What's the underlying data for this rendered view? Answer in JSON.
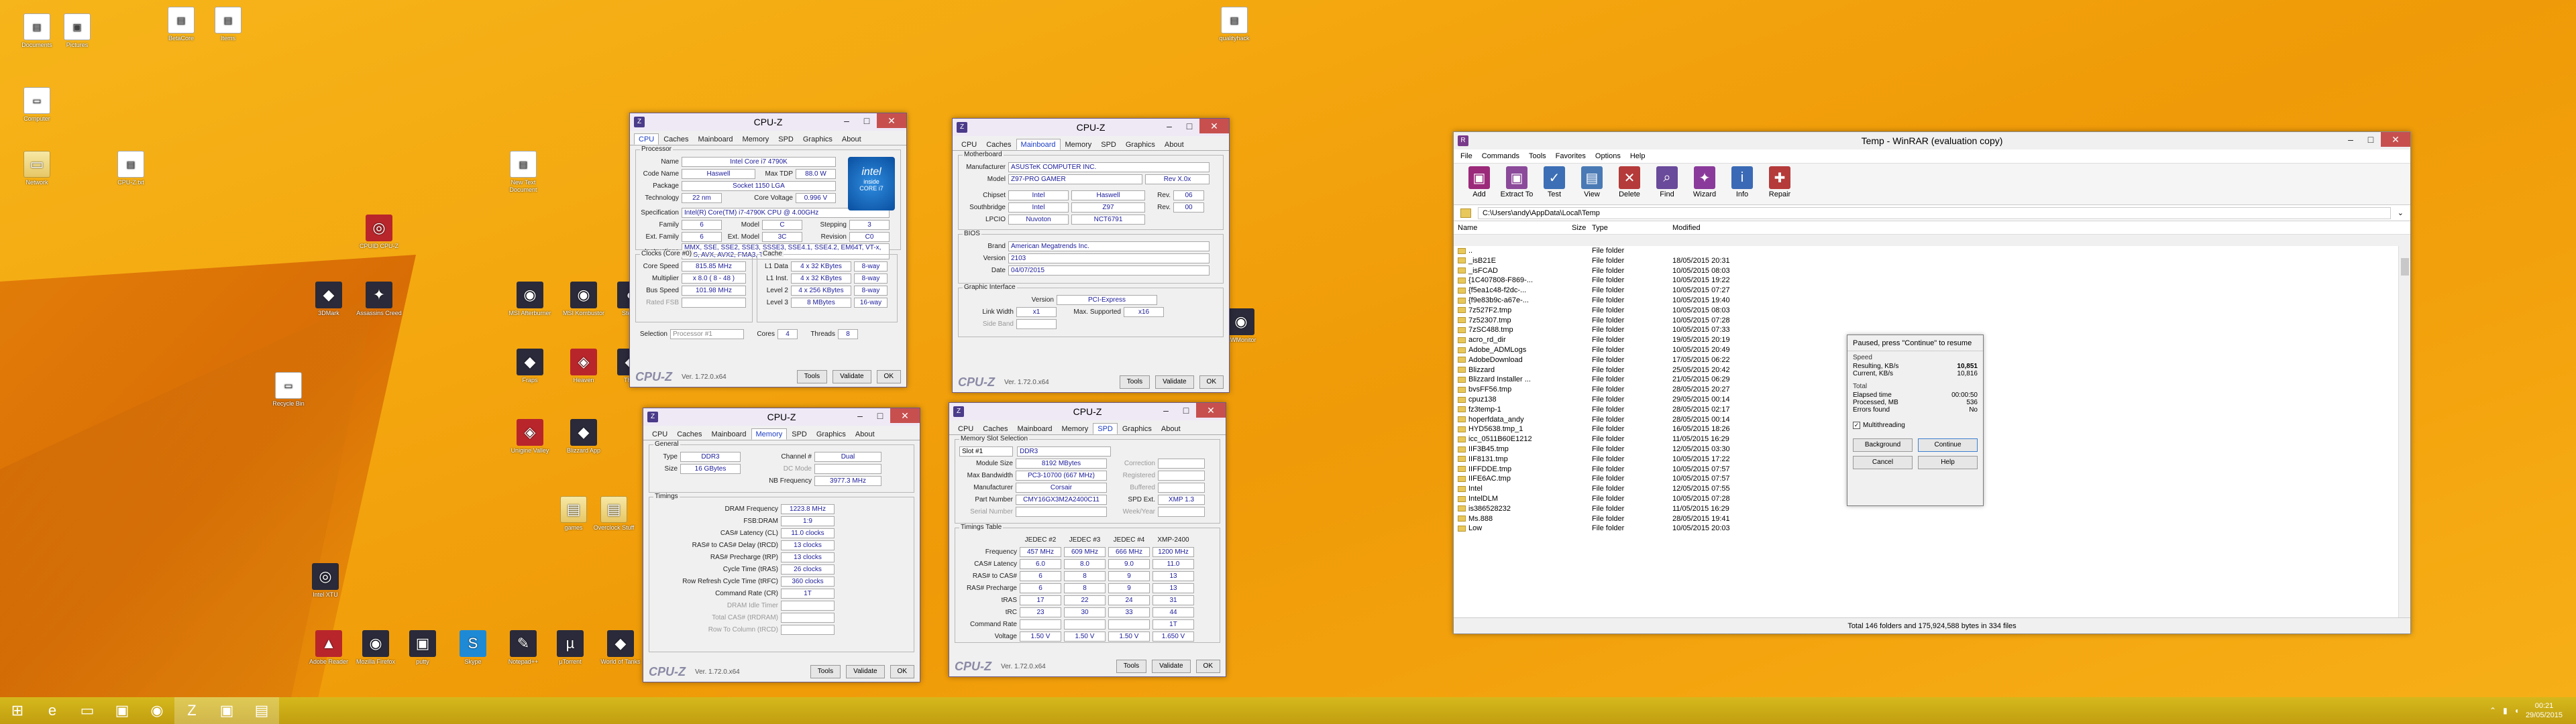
{
  "desktop": {
    "icons": [
      {
        "label": "Documents",
        "glyph": "▤",
        "kind": "doc"
      },
      {
        "label": "Pictures",
        "glyph": "▣",
        "kind": "doc"
      },
      {
        "label": "BetaCore",
        "glyph": "▤",
        "kind": "doc"
      },
      {
        "label": "Items",
        "glyph": "▤",
        "kind": "doc"
      },
      {
        "label": "Computer",
        "glyph": "▭",
        "kind": "doc"
      },
      {
        "label": "Network",
        "glyph": "▭",
        "kind": "fold"
      },
      {
        "label": "CPU-Z.txt",
        "glyph": "▤",
        "kind": "doc"
      },
      {
        "label": "New Text Document",
        "glyph": "▤",
        "kind": "doc"
      },
      {
        "label": "CPUID CPU-Z",
        "glyph": "◎",
        "kind": "red"
      },
      {
        "label": "3DMark",
        "glyph": "◆",
        "kind": "dark"
      },
      {
        "label": "Assassins Creed",
        "glyph": "✦",
        "kind": "dark"
      },
      {
        "label": "MSI Afterburner",
        "glyph": "◉",
        "kind": "dark"
      },
      {
        "label": "MSI Kombustor",
        "glyph": "◉",
        "kind": "dark"
      },
      {
        "label": "Steam",
        "glyph": "◐",
        "kind": "dark"
      },
      {
        "label": "Fraps",
        "glyph": "◆",
        "kind": "dark"
      },
      {
        "label": "Heaven",
        "glyph": "◈",
        "kind": "red"
      },
      {
        "label": "Thief",
        "glyph": "◆",
        "kind": "dark"
      },
      {
        "label": "Unigine Valley",
        "glyph": "◈",
        "kind": "red"
      },
      {
        "label": "Blizzard App",
        "glyph": "◆",
        "kind": "dark"
      },
      {
        "label": "Recycle Bin",
        "glyph": "▭",
        "kind": "doc"
      },
      {
        "label": "qualityhack",
        "glyph": "▤",
        "kind": "doc"
      },
      {
        "label": "games",
        "glyph": "▤",
        "kind": "fold"
      },
      {
        "label": "Overclock Stuff",
        "glyph": "▤",
        "kind": "fold"
      },
      {
        "label": "Adobe Reader",
        "glyph": "▲",
        "kind": "red"
      },
      {
        "label": "Mozilla Firefox",
        "glyph": "◉",
        "kind": "dark"
      },
      {
        "label": "putty",
        "glyph": "▣",
        "kind": "dark"
      },
      {
        "label": "Skype",
        "glyph": "S",
        "kind": "blue"
      },
      {
        "label": "Notepad++",
        "glyph": "✎",
        "kind": "dark"
      },
      {
        "label": "µTorrent",
        "glyph": "µ",
        "kind": "dark"
      },
      {
        "label": "World of Tanks",
        "glyph": "◆",
        "kind": "dark"
      },
      {
        "label": "Intel XTU",
        "glyph": "◎",
        "kind": "dark"
      },
      {
        "label": "HWMonitor",
        "glyph": "◉",
        "kind": "dark"
      }
    ]
  },
  "cpuz1": {
    "title": "CPU-Z",
    "tabs": [
      "CPU",
      "Caches",
      "Mainboard",
      "Memory",
      "SPD",
      "Graphics",
      "About"
    ],
    "active": "CPU",
    "processor_label": "Processor",
    "name_k": "Name",
    "name": "Intel Core i7 4790K",
    "code_k": "Code Name",
    "code": "Haswell",
    "tdp_k": "Max TDP",
    "tdp": "88.0 W",
    "package_k": "Package",
    "package": "Socket 1150 LGA",
    "tech_k": "Technology",
    "tech": "22 nm",
    "volt_k": "Core Voltage",
    "volt": "0.996 V",
    "spec_k": "Specification",
    "spec": "Intel(R) Core(TM) i7-4790K CPU @ 4.00GHz",
    "fam_k": "Family",
    "fam": "6",
    "model_k": "Model",
    "model": "C",
    "step_k": "Stepping",
    "step": "3",
    "efam_k": "Ext. Family",
    "efam": "6",
    "emod_k": "Ext. Model",
    "emod": "3C",
    "rev_k": "Revision",
    "rev": "C0",
    "instr_k": "Instructions",
    "instr": "MMX, SSE, SSE2, SSE3, SSSE3, SSE4.1, SSE4.2, EM64T, VT-x, AES, AVX, AVX2, FMA3, TSX",
    "clocks_label": "Clocks (Core #0)",
    "cs_k": "Core Speed",
    "cs": "815.85 MHz",
    "mul_k": "Multiplier",
    "mul": "x 8.0 ( 8 - 48 )",
    "bus_k": "Bus Speed",
    "bus": "101.98 MHz",
    "fsb_k": "Rated FSB",
    "fsb": "",
    "cache_label": "Cache",
    "l1d_k": "L1 Data",
    "l1d": "4 x 32 KBytes",
    "l1d_w": "8-way",
    "l1i_k": "L1 Inst.",
    "l1i": "4 x 32 KBytes",
    "l1i_w": "8-way",
    "l2_k": "Level 2",
    "l2": "4 x 256 KBytes",
    "l2_w": "8-way",
    "l3_k": "Level 3",
    "l3": "8 MBytes",
    "l3_w": "16-way",
    "sel_k": "Selection",
    "sel": "Processor #1",
    "cores_k": "Cores",
    "cores": "4",
    "threads_k": "Threads",
    "threads": "8",
    "logo": "CPU-Z",
    "ver": "Ver. 1.72.0.x64",
    "tools": "Tools",
    "validate": "Validate",
    "ok": "OK",
    "intel_a": "intel",
    "intel_b": "inside",
    "intel_c": "CORE i7"
  },
  "cpuz2": {
    "title": "CPU-Z",
    "tabs": [
      "CPU",
      "Caches",
      "Mainboard",
      "Memory",
      "SPD",
      "Graphics",
      "About"
    ],
    "active": "Mainboard",
    "mb_label": "Motherboard",
    "man_k": "Manufacturer",
    "man": "ASUSTeK COMPUTER INC.",
    "model_k": "Model",
    "model": "Z97-PRO GAMER",
    "rev": "Rev X.0x",
    "chip_k": "Chipset",
    "chip_a": "Intel",
    "chip_b": "Haswell",
    "chip_rk": "Rev.",
    "chip_r": "06",
    "sb_k": "Southbridge",
    "sb_a": "Intel",
    "sb_b": "Z97",
    "sb_rk": "Rev.",
    "sb_r": "00",
    "lpc_k": "LPCIO",
    "lpc_a": "Nuvoton",
    "lpc_b": "NCT6791",
    "bios_label": "BIOS",
    "brand_k": "Brand",
    "brand": "American Megatrends Inc.",
    "ver_k": "Version",
    "ver": "2103",
    "date_k": "Date",
    "date": "04/07/2015",
    "gi_label": "Graphic Interface",
    "giv_k": "Version",
    "giv": "PCI-Express",
    "lw_k": "Link Width",
    "lw": "x1",
    "ms_k": "Max. Supported",
    "ms": "x16",
    "sb2_k": "Side Band",
    "sb2": "",
    "logo": "CPU-Z",
    "verno": "Ver. 1.72.0.x64",
    "tools": "Tools",
    "validate": "Validate",
    "ok": "OK"
  },
  "cpuz3": {
    "title": "CPU-Z",
    "tabs": [
      "CPU",
      "Caches",
      "Mainboard",
      "Memory",
      "SPD",
      "Graphics",
      "About"
    ],
    "active": "Memory",
    "gen_label": "General",
    "type_k": "Type",
    "type": "DDR3",
    "ch_k": "Channel #",
    "ch": "Dual",
    "size_k": "Size",
    "size": "16 GBytes",
    "dc_k": "DC Mode",
    "dc": "",
    "nb_k": "NB Frequency",
    "nb": "3977.3 MHz",
    "tim_label": "Timings",
    "t1_k": "DRAM Frequency",
    "t1": "1223.8 MHz",
    "t2_k": "FSB:DRAM",
    "t2": "1:9",
    "t3_k": "CAS# Latency (CL)",
    "t3": "11.0 clocks",
    "t4_k": "RAS# to CAS# Delay (tRCD)",
    "t4": "13 clocks",
    "t5_k": "RAS# Precharge (tRP)",
    "t5": "13 clocks",
    "t6_k": "Cycle Time (tRAS)",
    "t6": "26 clocks",
    "t7_k": "Row Refresh Cycle Time (tRFC)",
    "t7": "360 clocks",
    "t8_k": "Command Rate (CR)",
    "t8": "1T",
    "t9_k": "DRAM Idle Timer",
    "t9": "",
    "t10_k": "Total CAS# (tRDRAM)",
    "t10": "",
    "t11_k": "Row To Column (tRCD)",
    "t11": "",
    "logo": "CPU-Z",
    "ver": "Ver. 1.72.0.x64",
    "tools": "Tools",
    "validate": "Validate",
    "ok": "OK"
  },
  "cpuz4": {
    "title": "CPU-Z",
    "tabs": [
      "CPU",
      "Caches",
      "Mainboard",
      "Memory",
      "SPD",
      "Graphics",
      "About"
    ],
    "active": "SPD",
    "slot_label": "Memory Slot Selection",
    "slot": "Slot #1",
    "slot_type": "DDR3",
    "ms_k": "Module Size",
    "ms": "8192 MBytes",
    "corr_k": "Correction",
    "corr": "",
    "bw_k": "Max Bandwidth",
    "bw": "PC3-10700 (667 MHz)",
    "reg_k": "Registered",
    "reg": "",
    "man_k": "Manufacturer",
    "man": "Corsair",
    "buf_k": "Buffered",
    "buf": "",
    "pn_k": "Part Number",
    "pn": "CMY16GX3M2A2400C11",
    "spd_k": "SPD Ext.",
    "spd": "XMP 1.3",
    "sn_k": "Serial Number",
    "sn": "",
    "wk_k": "Week/Year",
    "wk": "",
    "tt_label": "Timings Table",
    "cols": [
      "JEDEC #2",
      "JEDEC #3",
      "JEDEC #4",
      "XMP-2400"
    ],
    "rows": [
      {
        "k": "Frequency",
        "v": [
          "457 MHz",
          "609 MHz",
          "666 MHz",
          "1200 MHz"
        ]
      },
      {
        "k": "CAS# Latency",
        "v": [
          "6.0",
          "8.0",
          "9.0",
          "11.0"
        ]
      },
      {
        "k": "RAS# to CAS#",
        "v": [
          "6",
          "8",
          "9",
          "13"
        ]
      },
      {
        "k": "RAS# Precharge",
        "v": [
          "6",
          "8",
          "9",
          "13"
        ]
      },
      {
        "k": "tRAS",
        "v": [
          "17",
          "22",
          "24",
          "31"
        ]
      },
      {
        "k": "tRC",
        "v": [
          "23",
          "30",
          "33",
          "44"
        ]
      },
      {
        "k": "Command Rate",
        "v": [
          "",
          "",
          "",
          "1T"
        ]
      },
      {
        "k": "Voltage",
        "v": [
          "1.50 V",
          "1.50 V",
          "1.50 V",
          "1.650 V"
        ]
      }
    ],
    "logo": "CPU-Z",
    "ver": "Ver. 1.72.0.x64",
    "tools": "Tools",
    "validate": "Validate",
    "ok": "OK"
  },
  "winrar": {
    "title": "Temp - WinRAR (evaluation copy)",
    "menu": [
      "File",
      "Commands",
      "Tools",
      "Favorites",
      "Options",
      "Help"
    ],
    "tools": [
      {
        "label": "Add",
        "glyph": "▣",
        "color": "#9b2a7a"
      },
      {
        "label": "Extract To",
        "glyph": "▣",
        "color": "#8b4a9a"
      },
      {
        "label": "Test",
        "glyph": "✓",
        "color": "#3c6fb5"
      },
      {
        "label": "View",
        "glyph": "▤",
        "color": "#4a7ab5"
      },
      {
        "label": "Delete",
        "glyph": "✕",
        "color": "#b53a3a"
      },
      {
        "label": "Find",
        "glyph": "⌕",
        "color": "#6a4a9a"
      },
      {
        "label": "Wizard",
        "glyph": "✦",
        "color": "#8a3a9a"
      },
      {
        "label": "Info",
        "glyph": "i",
        "color": "#3a6ab5"
      },
      {
        "label": "Repair",
        "glyph": "✚",
        "color": "#b53a3a"
      }
    ],
    "path": "C:\\Users\\andy\\AppData\\Local\\Temp",
    "cols": [
      "Name",
      "Size",
      "Type",
      "Modified"
    ],
    "files": [
      {
        "n": "..",
        "s": "",
        "t": "File folder",
        "m": ""
      },
      {
        "n": "_isB21E",
        "s": "",
        "t": "File folder",
        "m": "18/05/2015 20:31"
      },
      {
        "n": "_isFCAD",
        "s": "",
        "t": "File folder",
        "m": "10/05/2015 08:03"
      },
      {
        "n": "{1C407808-F869-...",
        "s": "",
        "t": "File folder",
        "m": "10/05/2015 19:22"
      },
      {
        "n": "{f5ea1c48-f2dc-...",
        "s": "",
        "t": "File folder",
        "m": "10/05/2015 07:27"
      },
      {
        "n": "{f9e83b9c-a67e-...",
        "s": "",
        "t": "File folder",
        "m": "10/05/2015 19:40"
      },
      {
        "n": "7z527F2.tmp",
        "s": "",
        "t": "File folder",
        "m": "10/05/2015 08:03"
      },
      {
        "n": "7z52307.tmp",
        "s": "",
        "t": "File folder",
        "m": "10/05/2015 07:28"
      },
      {
        "n": "7zSC488.tmp",
        "s": "",
        "t": "File folder",
        "m": "10/05/2015 07:33"
      },
      {
        "n": "acro_rd_dir",
        "s": "",
        "t": "File folder",
        "m": "19/05/2015 20:19"
      },
      {
        "n": "Adobe_ADMLogs",
        "s": "",
        "t": "File folder",
        "m": "10/05/2015 20:49"
      },
      {
        "n": "AdobeDownload",
        "s": "",
        "t": "File folder",
        "m": "17/05/2015 06:22"
      },
      {
        "n": "Blizzard",
        "s": "",
        "t": "File folder",
        "m": "25/05/2015 20:42"
      },
      {
        "n": "Blizzard Installer ...",
        "s": "",
        "t": "File folder",
        "m": "21/05/2015 06:29"
      },
      {
        "n": "bvsFF56.tmp",
        "s": "",
        "t": "File folder",
        "m": "28/05/2015 20:27"
      },
      {
        "n": "cpuz138",
        "s": "",
        "t": "File folder",
        "m": "29/05/2015 00:14"
      },
      {
        "n": "fz3temp-1",
        "s": "",
        "t": "File folder",
        "m": "28/05/2015 02:17"
      },
      {
        "n": "hoperfdata_andy",
        "s": "",
        "t": "File folder",
        "m": "28/05/2015 00:14"
      },
      {
        "n": "HYD5638.tmp_1",
        "s": "",
        "t": "File folder",
        "m": "16/05/2015 18:26"
      },
      {
        "n": "icc_0511B60E1212",
        "s": "",
        "t": "File folder",
        "m": "11/05/2015 16:29"
      },
      {
        "n": "IIF3B45.tmp",
        "s": "",
        "t": "File folder",
        "m": "12/05/2015 03:30"
      },
      {
        "n": "IIF8131.tmp",
        "s": "",
        "t": "File folder",
        "m": "10/05/2015 17:22"
      },
      {
        "n": "IIFFDDE.tmp",
        "s": "",
        "t": "File folder",
        "m": "10/05/2015 07:57"
      },
      {
        "n": "IIFE6AC.tmp",
        "s": "",
        "t": "File folder",
        "m": "10/05/2015 07:57"
      },
      {
        "n": "Intel",
        "s": "",
        "t": "File folder",
        "m": "12/05/2015 07:55"
      },
      {
        "n": "IntelDLM",
        "s": "",
        "t": "File folder",
        "m": "10/05/2015 07:28"
      },
      {
        "n": "is386528232",
        "s": "",
        "t": "File folder",
        "m": "11/05/2015 16:29"
      },
      {
        "n": "Ms.888",
        "s": "",
        "t": "File folder",
        "m": "28/05/2015 19:41"
      },
      {
        "n": "Low",
        "s": "",
        "t": "File folder",
        "m": "10/05/2015 20:03"
      }
    ],
    "status": "Total 146 folders and 175,924,588 bytes in 334 files"
  },
  "pause_dialog": {
    "title": "Paused, press \"Continue\" to resume",
    "speed_label": "Speed",
    "res_k": "Resulting, KB/s",
    "res": "10,851",
    "cur_k": "Current, KB/s",
    "cur": "10,816",
    "total_label": "Total",
    "el_k": "Elapsed time",
    "el": "00:00:50",
    "proc_k": "Processed, MB",
    "proc": "536",
    "err_k": "Errors found",
    "err": "No",
    "mt": "Multithreading",
    "bg": "Background",
    "cont": "Continue",
    "cancel": "Cancel",
    "help": "Help"
  },
  "taskbar": {
    "items": [
      {
        "name": "start",
        "glyph": "⊞"
      },
      {
        "name": "internet-explorer",
        "glyph": "e"
      },
      {
        "name": "file-explorer",
        "glyph": "▭"
      },
      {
        "name": "store",
        "glyph": "▣"
      },
      {
        "name": "firefox",
        "glyph": "◉"
      },
      {
        "name": "filezilla",
        "glyph": "Z"
      },
      {
        "name": "cpuz",
        "glyph": "▣"
      },
      {
        "name": "winrar",
        "glyph": "▤"
      }
    ],
    "time": "00:21",
    "date": "29/05/2015"
  }
}
